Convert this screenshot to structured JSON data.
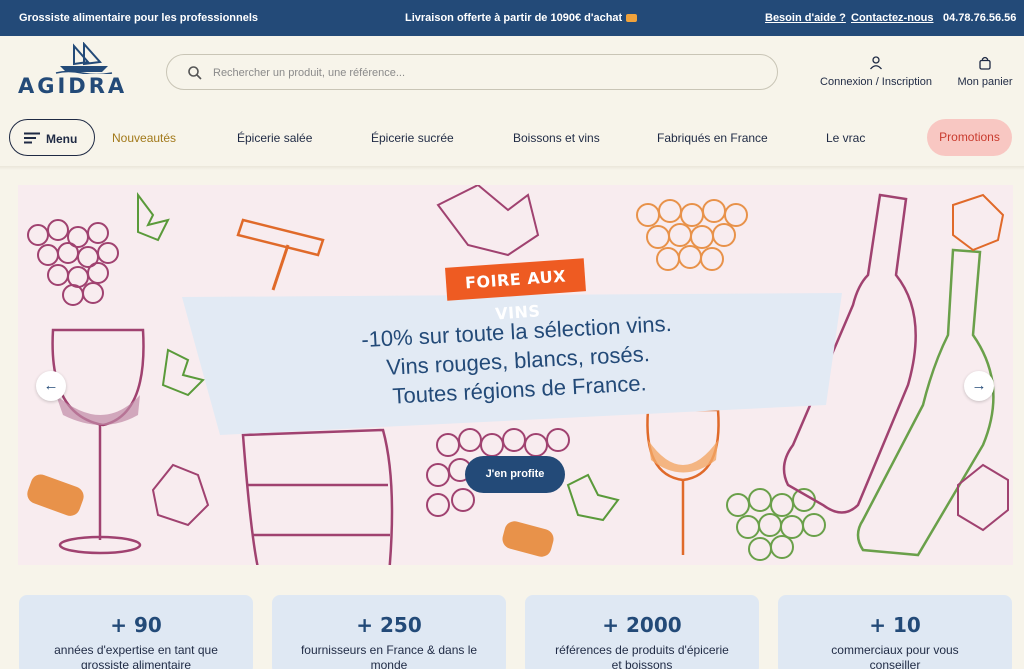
{
  "topbar": {
    "tagline": "Grossiste alimentaire pour les professionnels",
    "shipping": "Livraison offerte à partir de 1090€ d'achat",
    "help": "Besoin d'aide ?",
    "contact": "Contactez-nous",
    "phone": "04.78.76.56.56"
  },
  "header": {
    "logo": "AGIDRA",
    "search_placeholder": "Rechercher un produit, une référence...",
    "account": "Connexion / Inscription",
    "cart": "Mon panier"
  },
  "nav": {
    "menu": "Menu",
    "items": [
      "Nouveautés",
      "Épicerie salée",
      "Épicerie sucrée",
      "Boissons et vins",
      "Fabriqués en France",
      "Le vrac"
    ],
    "promo": "Promotions"
  },
  "hero": {
    "badge": "FOIRE AUX VINS",
    "line1": "-10% sur toute la sélection vins.",
    "line2": "Vins rouges, blancs, rosés.",
    "line3": "Toutes régions de France.",
    "cta": "J'en profite"
  },
  "stats": [
    {
      "num": "+ 90",
      "text": "années d'expertise en tant que grossiste alimentaire"
    },
    {
      "num": "+ 250",
      "text": "fournisseurs en France & dans le monde"
    },
    {
      "num": "+ 2000",
      "text": "références de produits d'épicerie et boissons"
    },
    {
      "num": "+ 10",
      "text": "commerciaux pour vous conseiller"
    }
  ],
  "colors": {
    "primary": "#234a78",
    "background": "#f7f4ea",
    "promo_bg": "#f8c7c2",
    "promo_text": "#c93b2e",
    "badge": "#ee5b22",
    "new_item": "#a2791a"
  },
  "icons": [
    "search-icon",
    "user-icon",
    "bag-icon",
    "burger-icon",
    "truck-icon",
    "arrow-left-icon",
    "arrow-right-icon",
    "boat-logo-icon"
  ]
}
